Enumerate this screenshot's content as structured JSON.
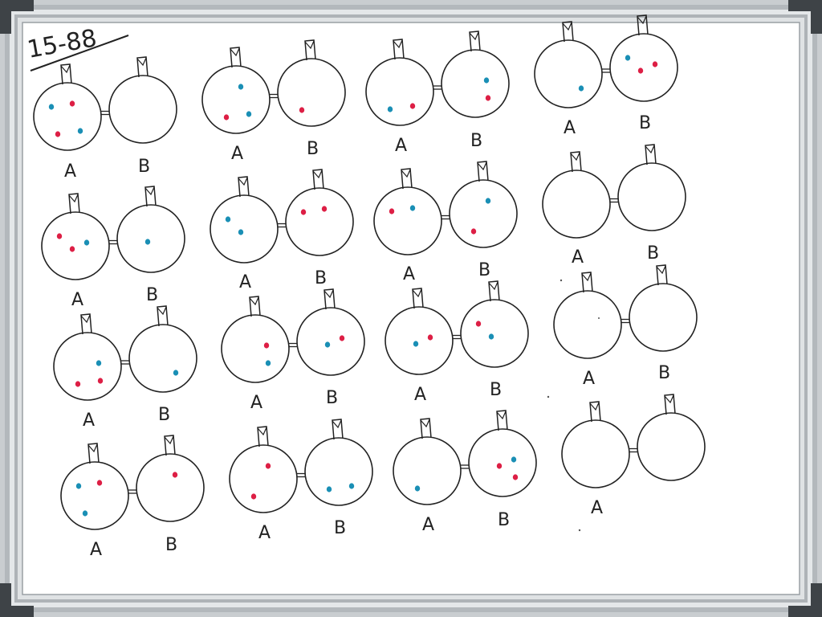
{
  "problem_label": "15-88",
  "label_a": "A",
  "label_b": "B",
  "colors": {
    "frame": "#9aa0a4",
    "frame_light": "#d2d6d9",
    "board": "#ffffff",
    "ink": "#222222",
    "particle_red": "#dd1f45",
    "particle_blue": "#1a8fb5"
  },
  "particle_kinds": [
    "blue",
    "red"
  ],
  "diagrams": [
    {
      "id": "r1c1",
      "tank_a": [
        {
          "type": "blue"
        },
        {
          "type": "red"
        },
        {
          "type": "red"
        },
        {
          "type": "blue"
        }
      ],
      "tank_b": [],
      "labels": [
        "A",
        "B"
      ]
    },
    {
      "id": "r1c2",
      "tank_a": [
        {
          "type": "blue"
        },
        {
          "type": "red"
        },
        {
          "type": "blue"
        }
      ],
      "tank_b": [
        {
          "type": "red"
        }
      ],
      "labels": [
        "A",
        "B"
      ]
    },
    {
      "id": "r1c3",
      "tank_a": [
        {
          "type": "blue"
        },
        {
          "type": "red"
        }
      ],
      "tank_b": [
        {
          "type": "red"
        },
        {
          "type": "blue"
        }
      ],
      "labels": [
        "A",
        "B"
      ]
    },
    {
      "id": "r1c4",
      "tank_a": [
        {
          "type": "blue"
        }
      ],
      "tank_b": [
        {
          "type": "red"
        },
        {
          "type": "red"
        },
        {
          "type": "blue"
        }
      ],
      "labels": [
        "A",
        "B"
      ]
    },
    {
      "id": "r2c1",
      "tank_a": [
        {
          "type": "blue"
        },
        {
          "type": "red"
        },
        {
          "type": "red"
        }
      ],
      "tank_b": [
        {
          "type": "blue"
        }
      ],
      "labels": [
        "A",
        "B"
      ]
    },
    {
      "id": "r2c2",
      "tank_a": [
        {
          "type": "blue"
        },
        {
          "type": "blue"
        }
      ],
      "tank_b": [
        {
          "type": "red"
        },
        {
          "type": "red"
        }
      ],
      "labels": [
        "A",
        "B"
      ]
    },
    {
      "id": "r2c3",
      "tank_a": [
        {
          "type": "red"
        },
        {
          "type": "blue"
        }
      ],
      "tank_b": [
        {
          "type": "blue"
        },
        {
          "type": "red"
        }
      ],
      "labels": [
        "A",
        "B"
      ]
    },
    {
      "id": "r2c4",
      "tank_a": [],
      "tank_b": [],
      "labels": [
        "A",
        "B"
      ]
    },
    {
      "id": "r3c1",
      "tank_a": [
        {
          "type": "red"
        },
        {
          "type": "red"
        },
        {
          "type": "blue"
        }
      ],
      "tank_b": [
        {
          "type": "blue"
        }
      ],
      "labels": [
        "A",
        "B"
      ]
    },
    {
      "id": "r3c2",
      "tank_a": [
        {
          "type": "blue"
        },
        {
          "type": "red"
        }
      ],
      "tank_b": [
        {
          "type": "red"
        },
        {
          "type": "blue"
        }
      ],
      "labels": [
        "A",
        "B"
      ]
    },
    {
      "id": "r3c3",
      "tank_a": [
        {
          "type": "red"
        },
        {
          "type": "blue"
        }
      ],
      "tank_b": [
        {
          "type": "blue"
        },
        {
          "type": "red"
        }
      ],
      "labels": [
        "A",
        "B"
      ]
    },
    {
      "id": "r3c4",
      "tank_a": [],
      "tank_b": [],
      "labels": [
        "A",
        "B"
      ]
    },
    {
      "id": "r4c1",
      "tank_a": [
        {
          "type": "blue"
        },
        {
          "type": "red"
        },
        {
          "type": "blue"
        }
      ],
      "tank_b": [
        {
          "type": "red"
        }
      ],
      "labels": [
        "A",
        "B"
      ]
    },
    {
      "id": "r4c2",
      "tank_a": [
        {
          "type": "red"
        },
        {
          "type": "red"
        }
      ],
      "tank_b": [
        {
          "type": "blue"
        },
        {
          "type": "blue"
        }
      ],
      "labels": [
        "A",
        "B"
      ]
    },
    {
      "id": "r4c3",
      "tank_a": [
        {
          "type": "blue"
        }
      ],
      "tank_b": [
        {
          "type": "red"
        },
        {
          "type": "blue"
        },
        {
          "type": "red"
        }
      ],
      "labels": [
        "A",
        "B"
      ]
    },
    {
      "id": "r4c4",
      "tank_a": [],
      "tank_b": [],
      "labels": [
        "A"
      ]
    }
  ]
}
